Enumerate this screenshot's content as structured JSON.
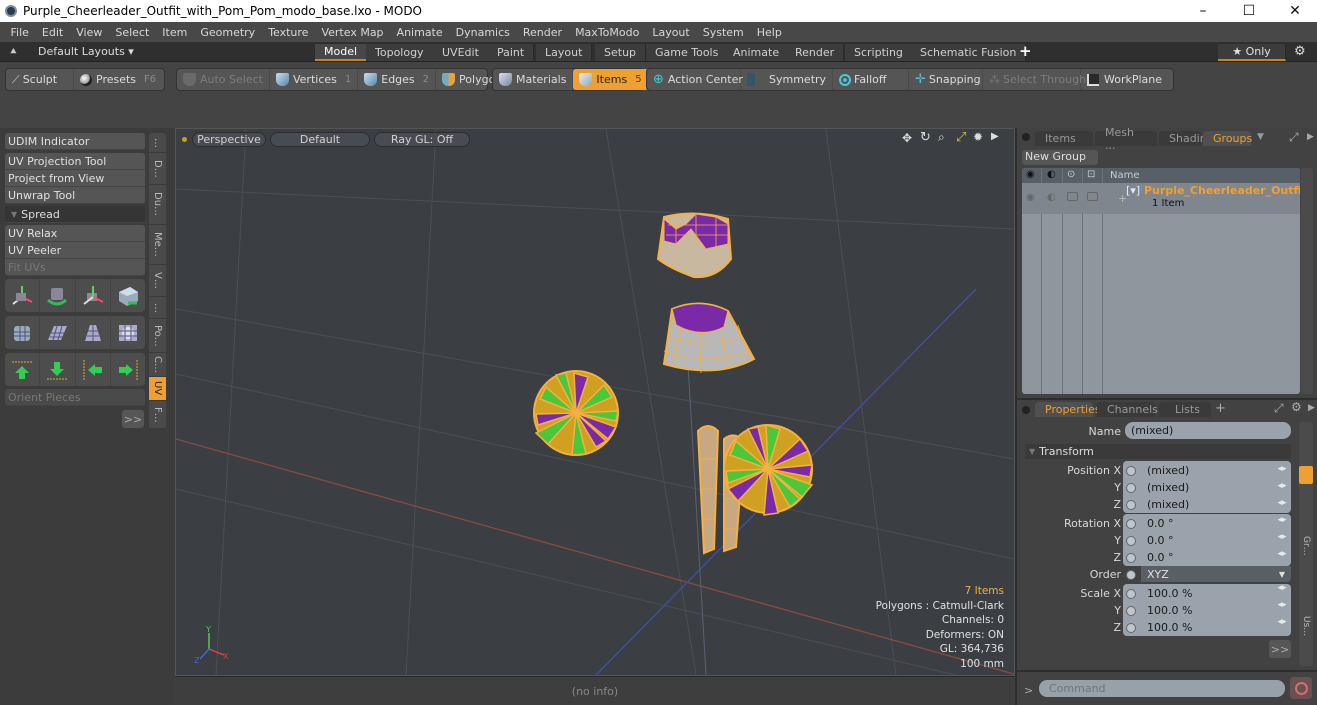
{
  "window": {
    "title": "Purple_Cheerleader_Outfit_with_Pom_Pom_modo_base.lxo - MODO",
    "minimize": "–",
    "maximize": "☐",
    "close": "✕"
  },
  "menu": [
    "File",
    "Edit",
    "View",
    "Select",
    "Item",
    "Geometry",
    "Texture",
    "Vertex Map",
    "Animate",
    "Dynamics",
    "Render",
    "MaxToModo",
    "Layout",
    "System",
    "Help"
  ],
  "layoutbar": {
    "layouts_label": "Default Layouts ▾",
    "tabs": [
      "Model",
      "Topology",
      "UVEdit",
      "Paint",
      "Layout",
      "Setup",
      "Game Tools",
      "Animate",
      "Render",
      "Scripting",
      "Schematic Fusion"
    ],
    "active_tab": "Model",
    "add_label": "+",
    "only_label": "★ Only",
    "gear": "⚙"
  },
  "toolbar": {
    "sculpt": "Sculpt",
    "presets": "Presets",
    "presets_key": "F6",
    "auto_select": "Auto Select",
    "vertices": "Vertices",
    "vertices_key": "1",
    "edges": "Edges",
    "edges_key": "2",
    "polygons": "Polygons",
    "materials": "Materials",
    "items": "Items",
    "items_key": "5",
    "action_center": "Action Center",
    "symmetry": "Symmetry",
    "falloff": "Falloff",
    "snapping": "Snapping",
    "select_through": "Select Through",
    "workplane": "WorkPlane"
  },
  "left_panel": {
    "udim": "UDIM Indicator",
    "tools": [
      "UV Projection Tool",
      "Project from View",
      "Unwrap Tool"
    ],
    "spread": "Spread",
    "relax_tools": [
      "UV Relax",
      "UV Peeler",
      "Fit UVs"
    ],
    "orient": "Orient Pieces",
    "more": ">>",
    "vtabs": [
      "…",
      "D…",
      "Du…",
      "Me…",
      "V…",
      "…",
      "Po…",
      "C…",
      "UV",
      "F…"
    ],
    "active_vtab": "UV"
  },
  "viewport": {
    "view": "Perspective",
    "shading": "Default",
    "raygl": "Ray GL: Off",
    "info": {
      "items": "7 Items",
      "polygons": "Polygons : Catmull-Clark",
      "channels": "Channels: 0",
      "deformers": "Deformers: ON",
      "gl": "GL: 364,736",
      "scale": "100 mm"
    },
    "status": "(no info)"
  },
  "groups_panel": {
    "tabs": [
      "Items",
      "Mesh ...",
      "Shading",
      "Groups"
    ],
    "active_tab": "Groups",
    "new_group": "New Group",
    "name_header": "Name",
    "group_name": "Purple_Cheerleader_Outfi...",
    "group_count": "1 Item"
  },
  "properties_panel": {
    "tabs": [
      "Properties",
      "Channels",
      "Lists"
    ],
    "active_tab": "Properties",
    "add": "+",
    "name_label": "Name",
    "name_value": "(mixed)",
    "section": "Transform",
    "position": {
      "label_x": "Position X",
      "label_y": "Y",
      "label_z": "Z",
      "x": "(mixed)",
      "y": "(mixed)",
      "z": "(mixed)"
    },
    "rotation": {
      "label_x": "Rotation X",
      "label_y": "Y",
      "label_z": "Z",
      "x": "0.0 °",
      "y": "0.0 °",
      "z": "0.0 °"
    },
    "order_label": "Order",
    "order_value": "XYZ",
    "scale": {
      "label_x": "Scale X",
      "label_y": "Y",
      "label_z": "Z",
      "x": "100.0 %",
      "y": "100.0 %",
      "z": "100.0 %"
    },
    "more": ">>",
    "side_tabs": [
      "…",
      "…",
      "",
      "…",
      "Gr…",
      "…",
      "…",
      "Us…"
    ]
  },
  "command": {
    "prompt": ">",
    "placeholder": "Command"
  },
  "colors": {
    "accent": "#f0a030",
    "selection": "#f5b040",
    "purple": "#7a2aa8",
    "green": "#4ac83a"
  }
}
